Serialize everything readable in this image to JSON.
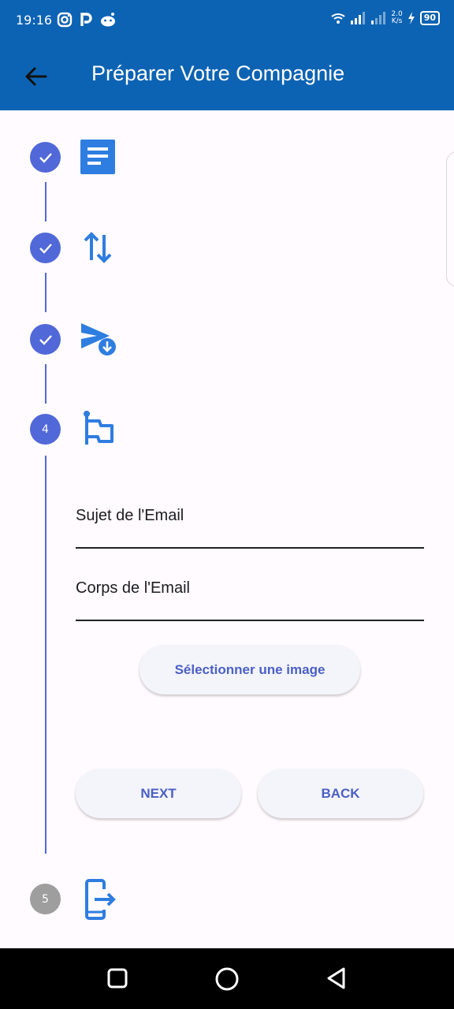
{
  "status_bar": {
    "time": "19:16",
    "speed_top": "2.0",
    "speed_bottom": "K/s",
    "battery": "90",
    "left_icons": [
      "instagram-icon",
      "p-icon",
      "reddit-icon"
    ],
    "right_icons": [
      "wifi-icon",
      "signal-icon",
      "signal-icon",
      "charging-icon",
      "battery-icon"
    ]
  },
  "app_bar": {
    "title": "Préparer Votre Compagnie",
    "back_icon": "arrow-back-icon"
  },
  "stepper": {
    "steps": [
      {
        "state": "completed",
        "label": "",
        "icon": "document-icon"
      },
      {
        "state": "completed",
        "label": "",
        "icon": "swap-vertical-icon"
      },
      {
        "state": "completed",
        "label": "",
        "icon": "send-download-icon"
      },
      {
        "state": "active",
        "label": "4",
        "icon": "flag-icon"
      },
      {
        "state": "pending",
        "label": "5",
        "icon": "exit-phone-icon"
      }
    ]
  },
  "form": {
    "subject_label": "Sujet de l'Email",
    "body_label": "Corps de l'Email",
    "select_image_label": "Sélectionner une image"
  },
  "controls": {
    "next_label": "NEXT",
    "back_label": "BACK"
  },
  "colors": {
    "app_bar": "#0d63b3",
    "step_active": "#5168d8",
    "step_pending": "#9e9e9e",
    "icon_blue": "#2e7de0",
    "button_text": "#4a5fc5"
  }
}
